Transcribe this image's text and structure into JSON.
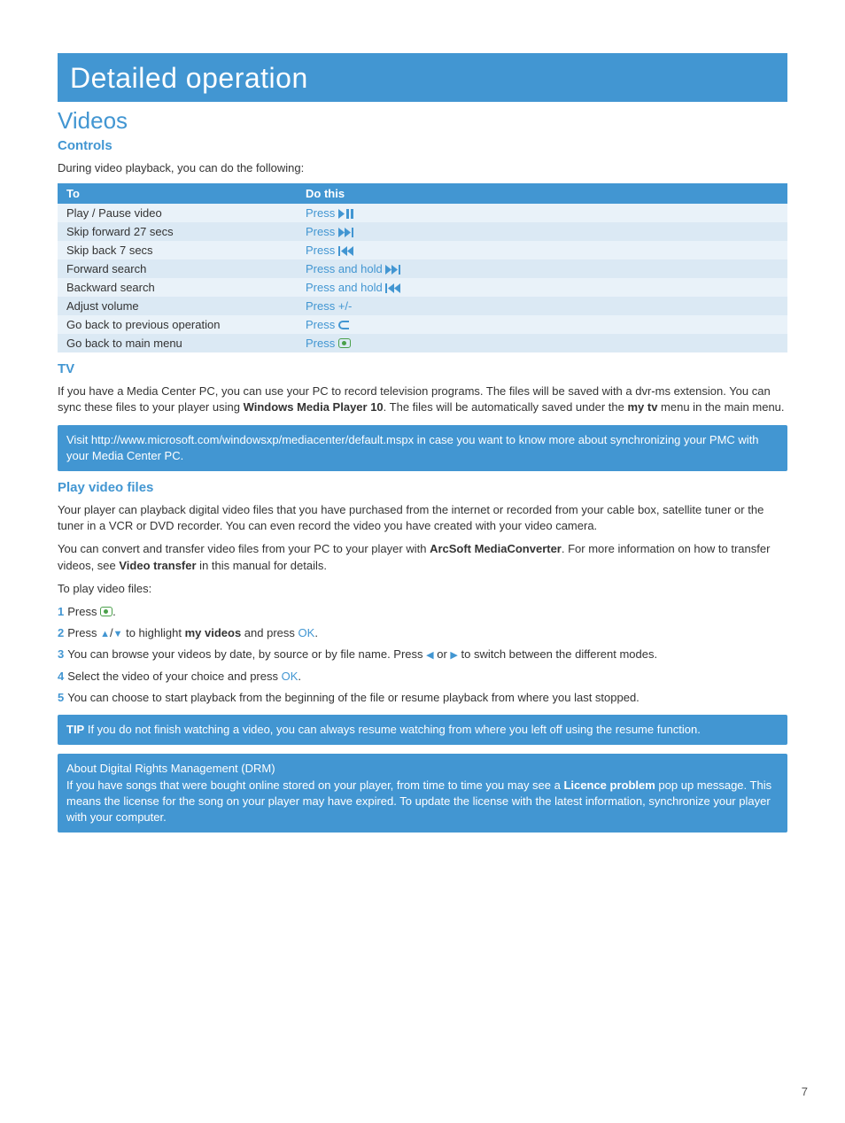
{
  "page_number": "7",
  "banner_title": "Detailed operation",
  "videos": {
    "title": "Videos",
    "controls": {
      "heading": "Controls",
      "intro": "During video playback, you can do the following:",
      "col_to": "To",
      "col_dothis": "Do this",
      "rows": [
        {
          "to": "Play / Pause video",
          "action_text": "Press ",
          "glyph": "play-pause"
        },
        {
          "to": "Skip forward 27 secs",
          "action_text": "Press ",
          "glyph": "skip-fwd"
        },
        {
          "to": "Skip back 7 secs",
          "action_text": "Press ",
          "glyph": "skip-back"
        },
        {
          "to": "Forward search",
          "action_text": "Press and hold ",
          "glyph": "skip-fwd"
        },
        {
          "to": "Backward search",
          "action_text": "Press and hold ",
          "glyph": "skip-back"
        },
        {
          "to": "Adjust volume",
          "action_text": "Press ",
          "glyph": "plus-minus"
        },
        {
          "to": "Go back to previous operation",
          "action_text": "Press ",
          "glyph": "back"
        },
        {
          "to": "Go back to main menu",
          "action_text": "Press ",
          "glyph": "mc"
        }
      ]
    },
    "tv": {
      "heading": "TV",
      "para_parts": {
        "p1": "If you have a Media Center PC, you can use your PC to record television programs. The files will be saved with a dvr-ms extension. You can sync these files to your player using ",
        "wmp": "Windows Media Player 10",
        "p2": ". The files will be automatically saved under the ",
        "mytv": "my tv",
        "p3": " menu in the main menu."
      },
      "callout": "Visit http://www.microsoft.com/windowsxp/mediacenter/default.mspx in case you want to know more about synchronizing your PMC with your Media Center PC."
    },
    "play": {
      "heading": "Play video files",
      "para1": "Your player can playback digital video files that you have purchased from the internet or recorded from your cable box, satellite tuner or the tuner in a VCR or DVD recorder. You can even record the video you have created with your video camera.",
      "para2_parts": {
        "a": "You can convert and transfer video files from your PC to your player with ",
        "arc": "ArcSoft MediaConverter",
        "b": ". For more information on how to transfer videos, see ",
        "vt": "Video transfer",
        "c": " in this manual for details."
      },
      "para3": "To play video files:",
      "steps": {
        "s1_a": "Press ",
        "s1_b": ".",
        "s2_a": "Press ",
        "s2_b": " to highlight ",
        "s2_myvideos": "my videos",
        "s2_c": " and press ",
        "s2_ok": "OK",
        "s2_d": ".",
        "s3_a": "You can browse your videos by date, by source or by file name. Press ",
        "s3_b": " or ",
        "s3_c": " to switch between the different modes.",
        "s4_a": "Select the video of your choice and press ",
        "s4_ok": "OK",
        "s4_b": ".",
        "s5": "You can choose to start playback from the beginning of the file or resume playback from where you last stopped."
      },
      "tip_label": "TIP",
      "tip_text": " If you do not finish watching a video, you can always resume watching from where you left off using the resume function.",
      "drm_title": "About Digital Rights Management (DRM)",
      "drm_body_parts": {
        "a": "If you have songs that were bought online stored on your player, from time to time you may see a ",
        "lp": "Licence problem",
        "b": " pop up message. This means the license for the song on your player may have expired. To update the license with the latest information, synchronize your player with your computer."
      }
    }
  }
}
